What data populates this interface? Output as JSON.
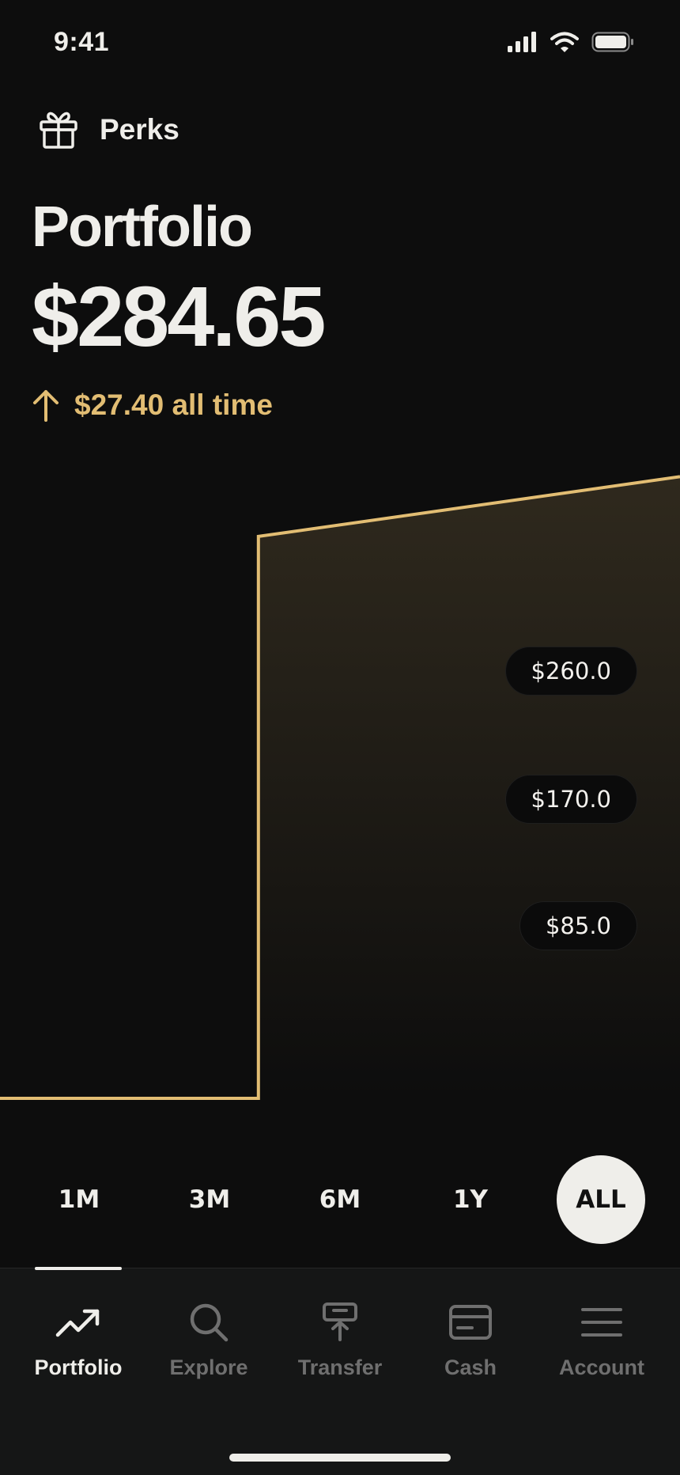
{
  "status_bar": {
    "time": "9:41",
    "icons": [
      "cellular-signal-icon",
      "wifi-icon",
      "battery-icon"
    ]
  },
  "perks": {
    "label": "Perks",
    "icon": "gift-icon"
  },
  "header": {
    "title": "Portfolio",
    "value": "$284.65",
    "change": "$27.40 all time",
    "change_direction_icon": "arrow-up-icon"
  },
  "colors": {
    "background": "#0d0d0d",
    "accent": "#e2bd73",
    "text": "#efeeea",
    "inactive_text": "#6f6f6f",
    "tab_bar": "#151616"
  },
  "chart_data": {
    "type": "line",
    "area_fill": true,
    "ylim": [
      0,
      300
    ],
    "y_tick_labels": [
      "$260.0",
      "$170.0",
      "$85.0"
    ],
    "series": [
      {
        "points": [
          [
            0,
            0
          ],
          [
            0.38,
            0
          ],
          [
            0.38,
            257.27
          ],
          [
            1.0,
            284.65
          ]
        ]
      }
    ]
  },
  "ranges": {
    "options": [
      "1M",
      "3M",
      "6M",
      "1Y",
      "ALL"
    ],
    "selected": "ALL"
  },
  "tabs": [
    {
      "label": "Portfolio",
      "icon": "trending-up-icon",
      "active": true
    },
    {
      "label": "Explore",
      "icon": "search-icon",
      "active": false
    },
    {
      "label": "Transfer",
      "icon": "transfer-icon",
      "active": false
    },
    {
      "label": "Cash",
      "icon": "card-icon",
      "active": false
    },
    {
      "label": "Account",
      "icon": "menu-icon",
      "active": false
    }
  ]
}
